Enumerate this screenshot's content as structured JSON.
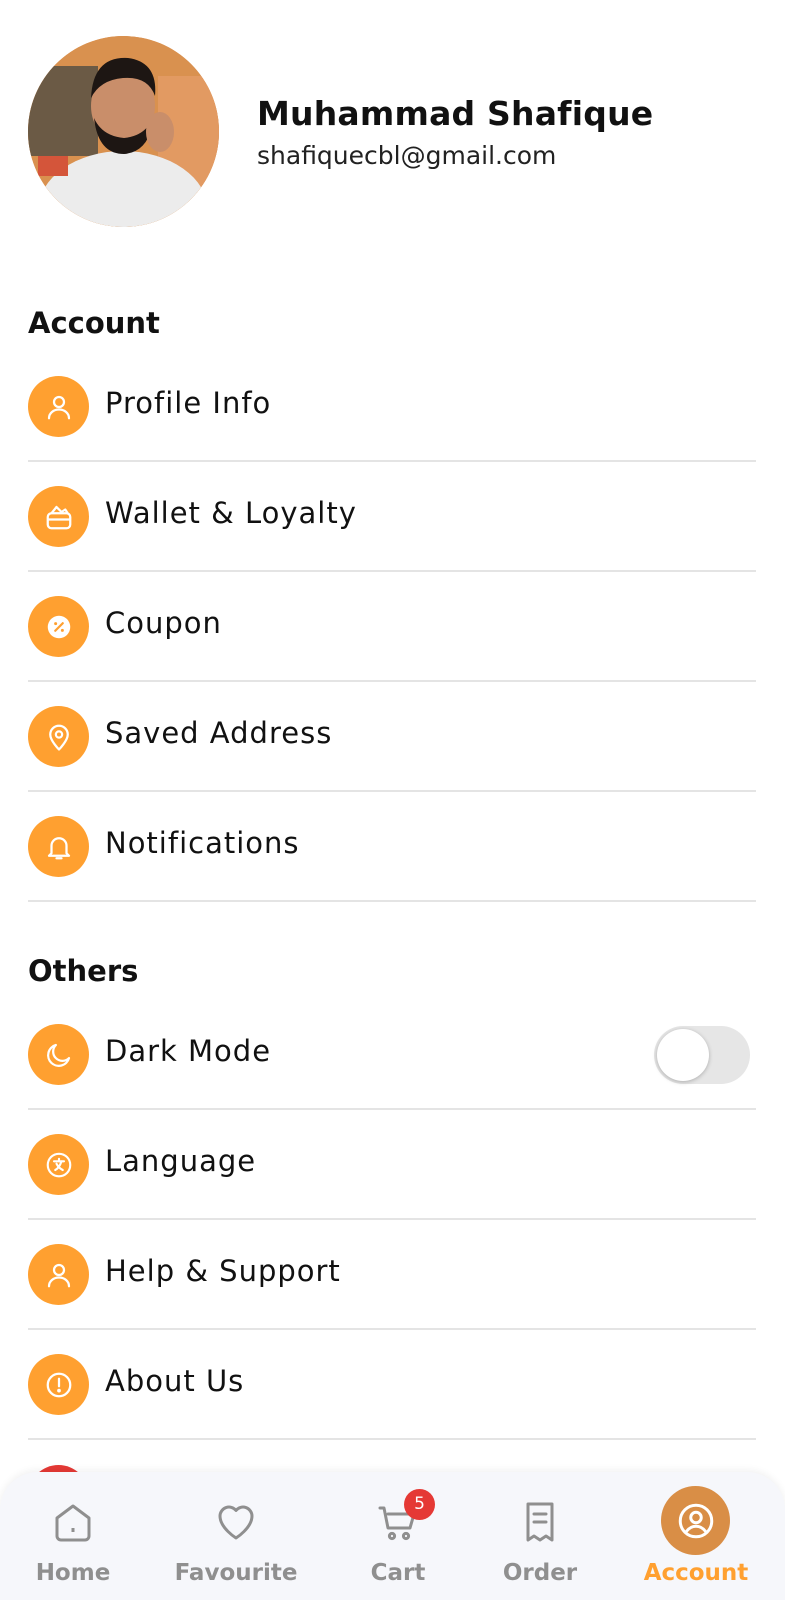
{
  "profile": {
    "name": "Muhammad Shafique",
    "email": "shafiquecbl@gmail.com"
  },
  "account_section": {
    "title": "Account",
    "items": [
      {
        "label": "Profile Info",
        "icon": "user-icon"
      },
      {
        "label": "Wallet & Loyalty",
        "icon": "wallet-icon"
      },
      {
        "label": "Coupon",
        "icon": "coupon-icon"
      },
      {
        "label": "Saved Address",
        "icon": "location-pin-icon"
      },
      {
        "label": "Notifications",
        "icon": "bell-icon"
      }
    ]
  },
  "others_section": {
    "title": "Others",
    "items": [
      {
        "label": "Dark Mode",
        "icon": "moon-icon",
        "toggle": false
      },
      {
        "label": "Language",
        "icon": "language-icon"
      },
      {
        "label": "Help & Support",
        "icon": "user-icon"
      },
      {
        "label": "About Us",
        "icon": "info-icon"
      }
    ]
  },
  "bottom_nav": {
    "items": [
      {
        "label": "Home",
        "icon": "home-icon"
      },
      {
        "label": "Favourite",
        "icon": "heart-icon"
      },
      {
        "label": "Cart",
        "icon": "cart-icon"
      },
      {
        "label": "Order",
        "icon": "receipt-icon"
      },
      {
        "label": "Account",
        "icon": "account-icon",
        "active": true
      }
    ],
    "cart_badge": "5"
  },
  "colors": {
    "accent": "#FFA030",
    "active_circle": "#D98E46",
    "badge": "#E53935",
    "inactive_nav": "#8f8f8f",
    "divider": "#e4e4e4"
  }
}
